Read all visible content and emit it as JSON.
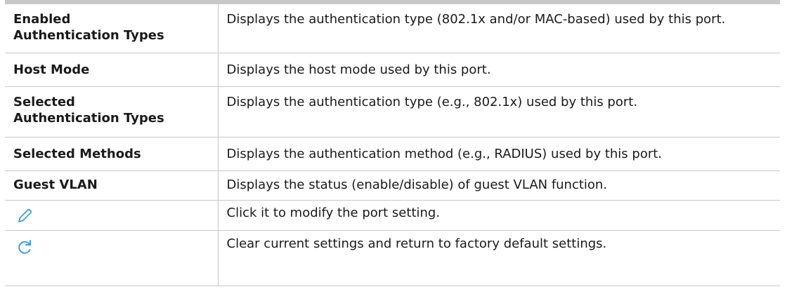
{
  "rows": [
    {
      "term": "Enabled\nAuthentication Types",
      "description": "Displays the authentication type (802.1x and/or MAC-based) used by this port."
    },
    {
      "term": "Host Mode",
      "description": "Displays the host mode used by this port."
    },
    {
      "term": "Selected\nAuthentication Types",
      "description": "Displays the authentication type (e.g., 802.1x) used by this port."
    },
    {
      "term": "Selected Methods",
      "description": "Displays the authentication method (e.g., RADIUS) used by this port."
    },
    {
      "term": "Guest VLAN",
      "description": "Displays the status (enable/disable) of guest VLAN function."
    },
    {
      "icon": "edit-pencil-icon",
      "description": "Click it to modify the port setting."
    },
    {
      "icon": "reset-refresh-icon",
      "description": "Clear current settings and return to factory default settings."
    }
  ],
  "colors": {
    "border": "#c8c8c8",
    "icon": "#3aa0e0",
    "text": "#1a1a1a"
  }
}
